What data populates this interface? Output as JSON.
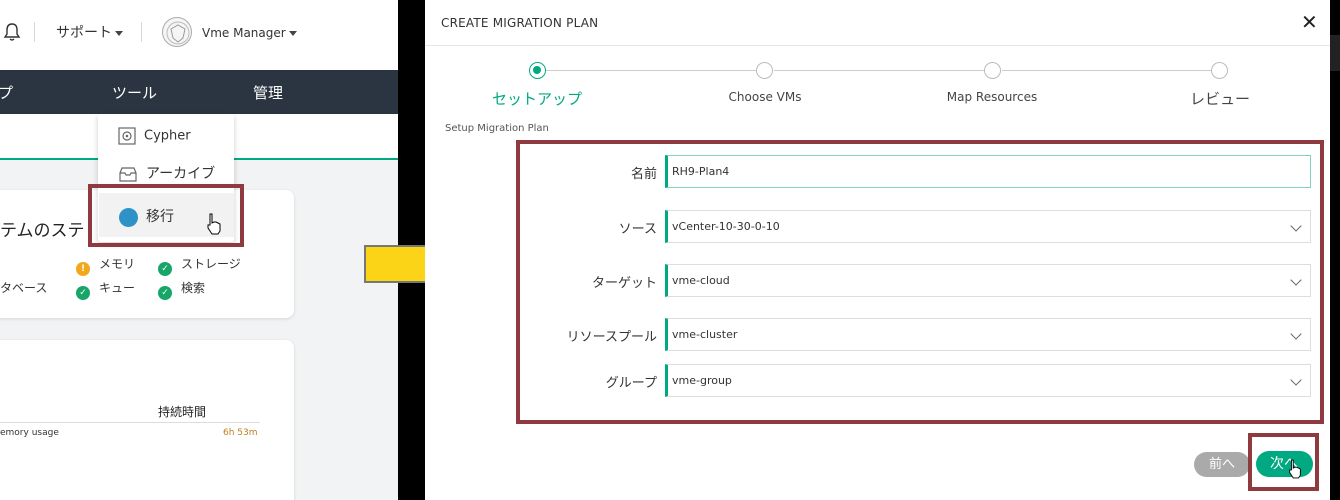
{
  "background_app": {
    "topbar": {
      "support_label": "サポート",
      "user_name": "Vme Manager"
    },
    "navbar": {
      "item1": "プ",
      "item2": "ツール",
      "item3": "管理"
    },
    "tools_menu": [
      {
        "label": "Cypher",
        "icon": "safe-icon"
      },
      {
        "label": "アーカイブ",
        "icon": "archive-icon"
      },
      {
        "label": "移行",
        "icon": "migration-icon"
      }
    ],
    "status_card": {
      "title": "テムのステ",
      "items": [
        {
          "label": "メモリ",
          "state": "warn"
        },
        {
          "label": "ストレージ",
          "state": "ok"
        },
        {
          "label": "タベース",
          "state": "ok"
        },
        {
          "label": "キュー",
          "state": "ok"
        },
        {
          "label": "検索",
          "state": "ok"
        }
      ]
    },
    "alerts_card": {
      "duration_header": "持続時間",
      "row_label": "emory usage",
      "row_duration": "6h 53m"
    }
  },
  "modal": {
    "title": "CREATE MIGRATION PLAN",
    "steps": [
      {
        "label": "セットアップ",
        "active": true
      },
      {
        "label": "Choose VMs",
        "active": false
      },
      {
        "label": "Map Resources",
        "active": false
      },
      {
        "label": "レビュー",
        "active": false
      }
    ],
    "subtitle": "Setup Migration Plan",
    "form": {
      "name": {
        "label": "名前",
        "value": "RH9-Plan4"
      },
      "source": {
        "label": "ソース",
        "value": "vCenter-10-30-0-10"
      },
      "target": {
        "label": "ターゲット",
        "value": "vme-cloud"
      },
      "resource_pool": {
        "label": "リソースプール",
        "value": "vme-cluster"
      },
      "group": {
        "label": "グループ",
        "value": "vme-group"
      }
    },
    "prev_label": "前へ",
    "next_label": "次へ"
  },
  "colors": {
    "accent": "#01a982",
    "highlight": "#8e3a3f",
    "nav": "#2b3541",
    "arrow": "#fbd417"
  }
}
